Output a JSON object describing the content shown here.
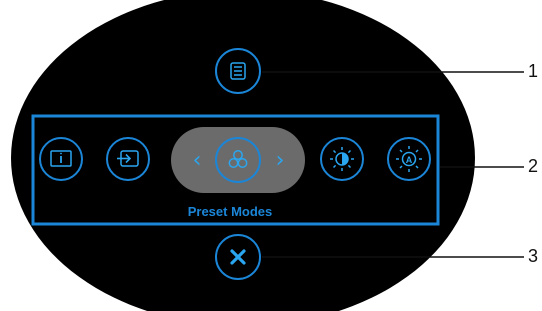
{
  "menu": {
    "preset_label": "Preset Modes",
    "buttons": [
      {
        "name": "menu-icon",
        "role": "main-menu"
      },
      {
        "name": "info-icon",
        "role": "display-info"
      },
      {
        "name": "input-source-icon",
        "role": "input-source"
      },
      {
        "name": "preset-modes-icon",
        "role": "preset-modes"
      },
      {
        "name": "brightness-contrast-icon",
        "role": "brightness-contrast"
      },
      {
        "name": "auto-adjust-icon",
        "role": "auto-adjust"
      },
      {
        "name": "close-icon",
        "role": "exit"
      }
    ]
  },
  "callouts": [
    "1",
    "2",
    "3"
  ],
  "colors": {
    "background": "#000000",
    "accent": "#1b86d8",
    "icon": "#2aa6f0",
    "selected_pill": "#6b6b6b"
  }
}
